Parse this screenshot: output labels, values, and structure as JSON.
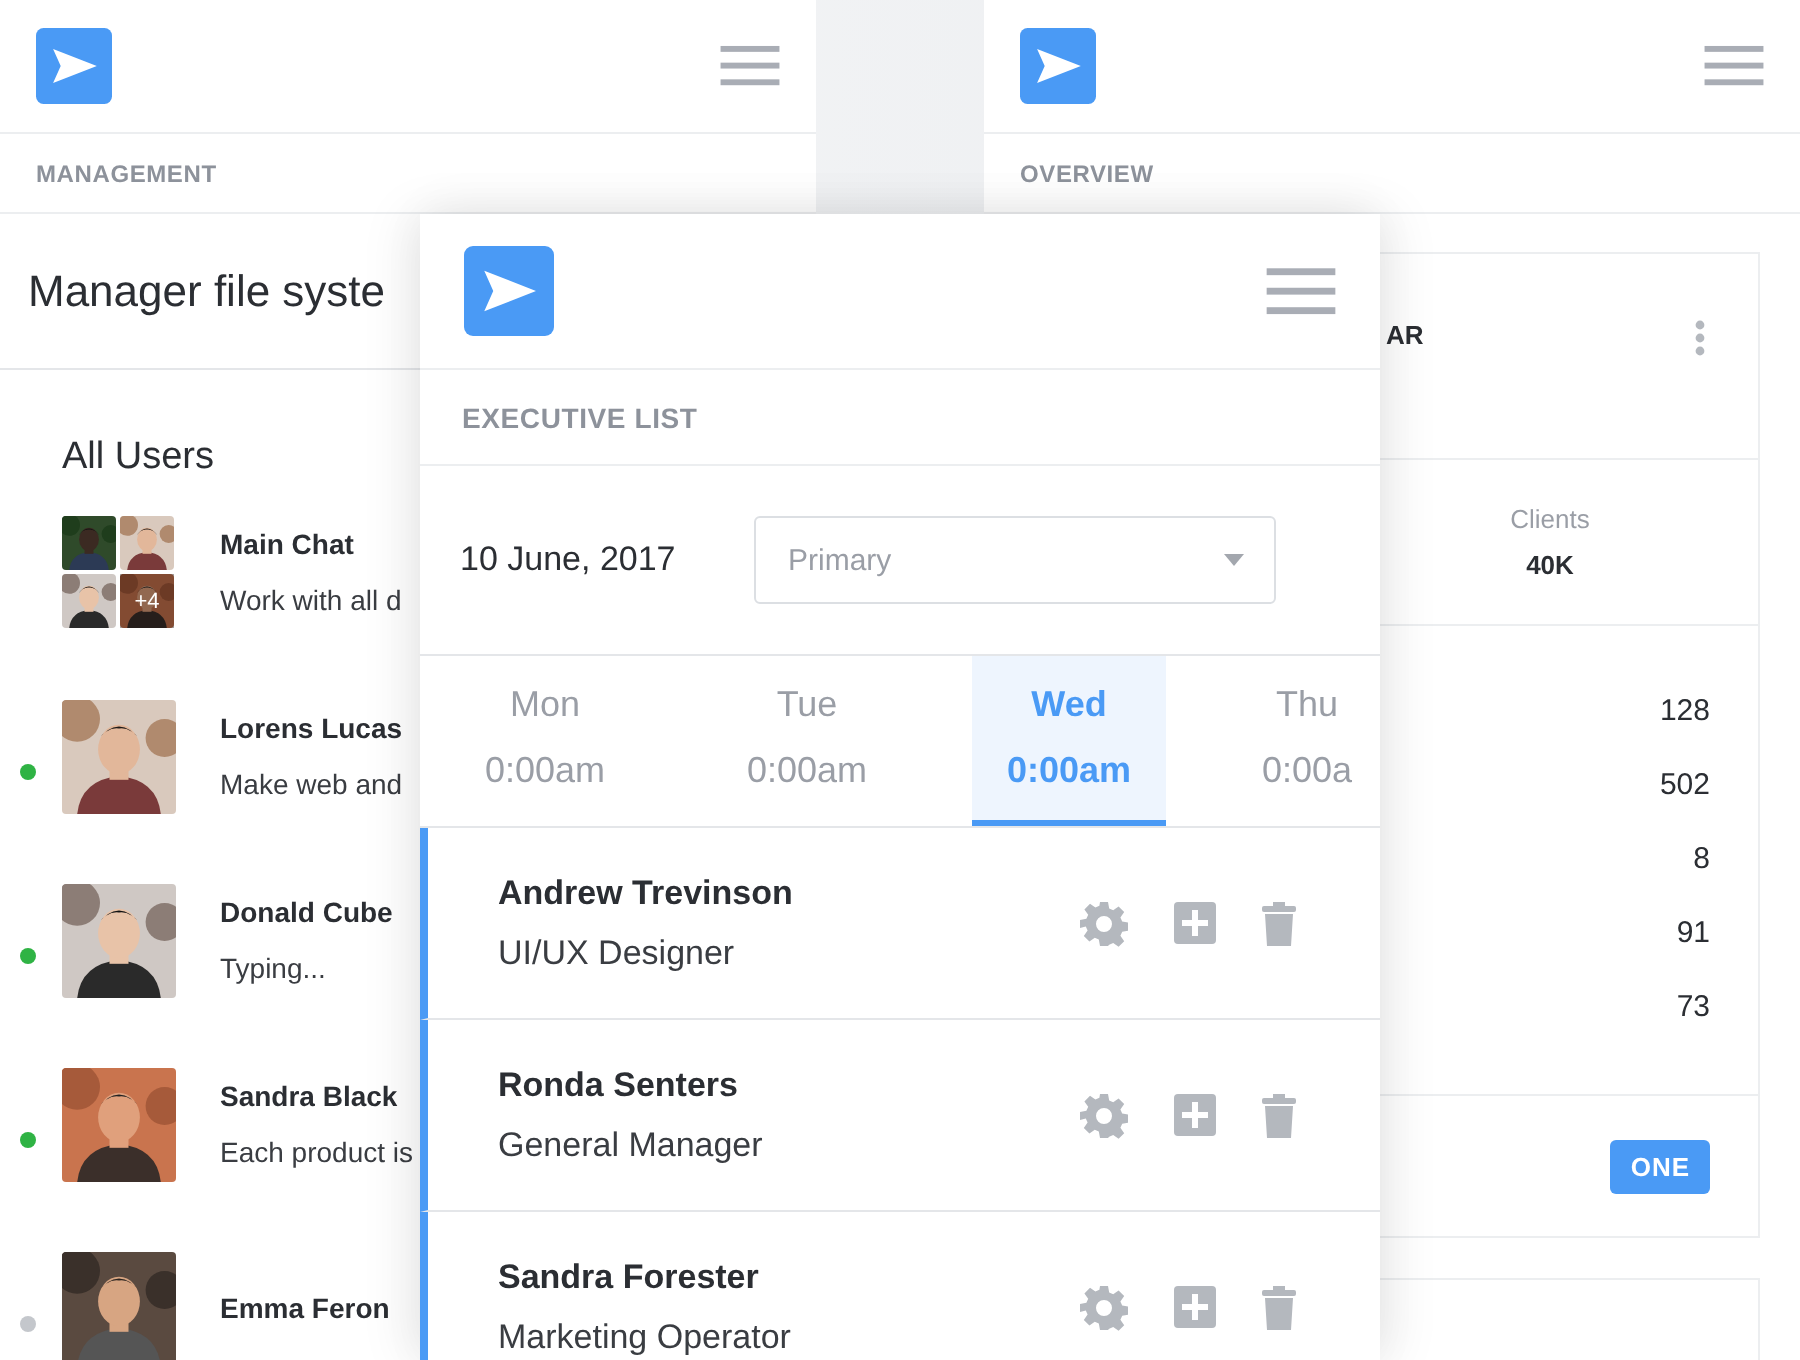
{
  "management_screen": {
    "section": "MANAGEMENT",
    "title": "Manager file syste",
    "list_title": "All Users",
    "users": [
      {
        "kind": "group",
        "name": "Main Chat",
        "message": "Work with all d",
        "extra_count": "+4"
      },
      {
        "kind": "person",
        "name": "Lorens Lucas",
        "message": "Make web and",
        "online": true
      },
      {
        "kind": "person",
        "name": "Donald Cube",
        "message": "Typing...",
        "online": true
      },
      {
        "kind": "person",
        "name": "Sandra Black",
        "message": "Each product is",
        "online": true
      },
      {
        "kind": "person",
        "name": "Emma Feron",
        "online": false
      }
    ]
  },
  "overview_screen": {
    "section": "OVERVIEW",
    "card": {
      "title": "AR",
      "stat_label": "Clients",
      "stat_value": "40K",
      "values": [
        "128",
        "502",
        "8",
        "91",
        "73"
      ],
      "button": "ONE"
    }
  },
  "executive_screen": {
    "section": "EXECUTIVE LIST",
    "date": "10 June, 2017",
    "select": {
      "placeholder": "Primary"
    },
    "days": [
      {
        "day": "Mon",
        "time": "0:00am",
        "selected": false
      },
      {
        "day": "Tue",
        "time": "0:00am",
        "selected": false
      },
      {
        "day": "Wed",
        "time": "0:00am",
        "selected": true
      },
      {
        "day": "Thu",
        "time": "0:00a",
        "selected": false
      }
    ],
    "employees": [
      {
        "name": "Andrew Trevinson",
        "role": "UI/UX Designer"
      },
      {
        "name": "Ronda Senters",
        "role": "General Manager"
      },
      {
        "name": "Sandra Forester",
        "role": "Marketing Operator"
      }
    ]
  }
}
